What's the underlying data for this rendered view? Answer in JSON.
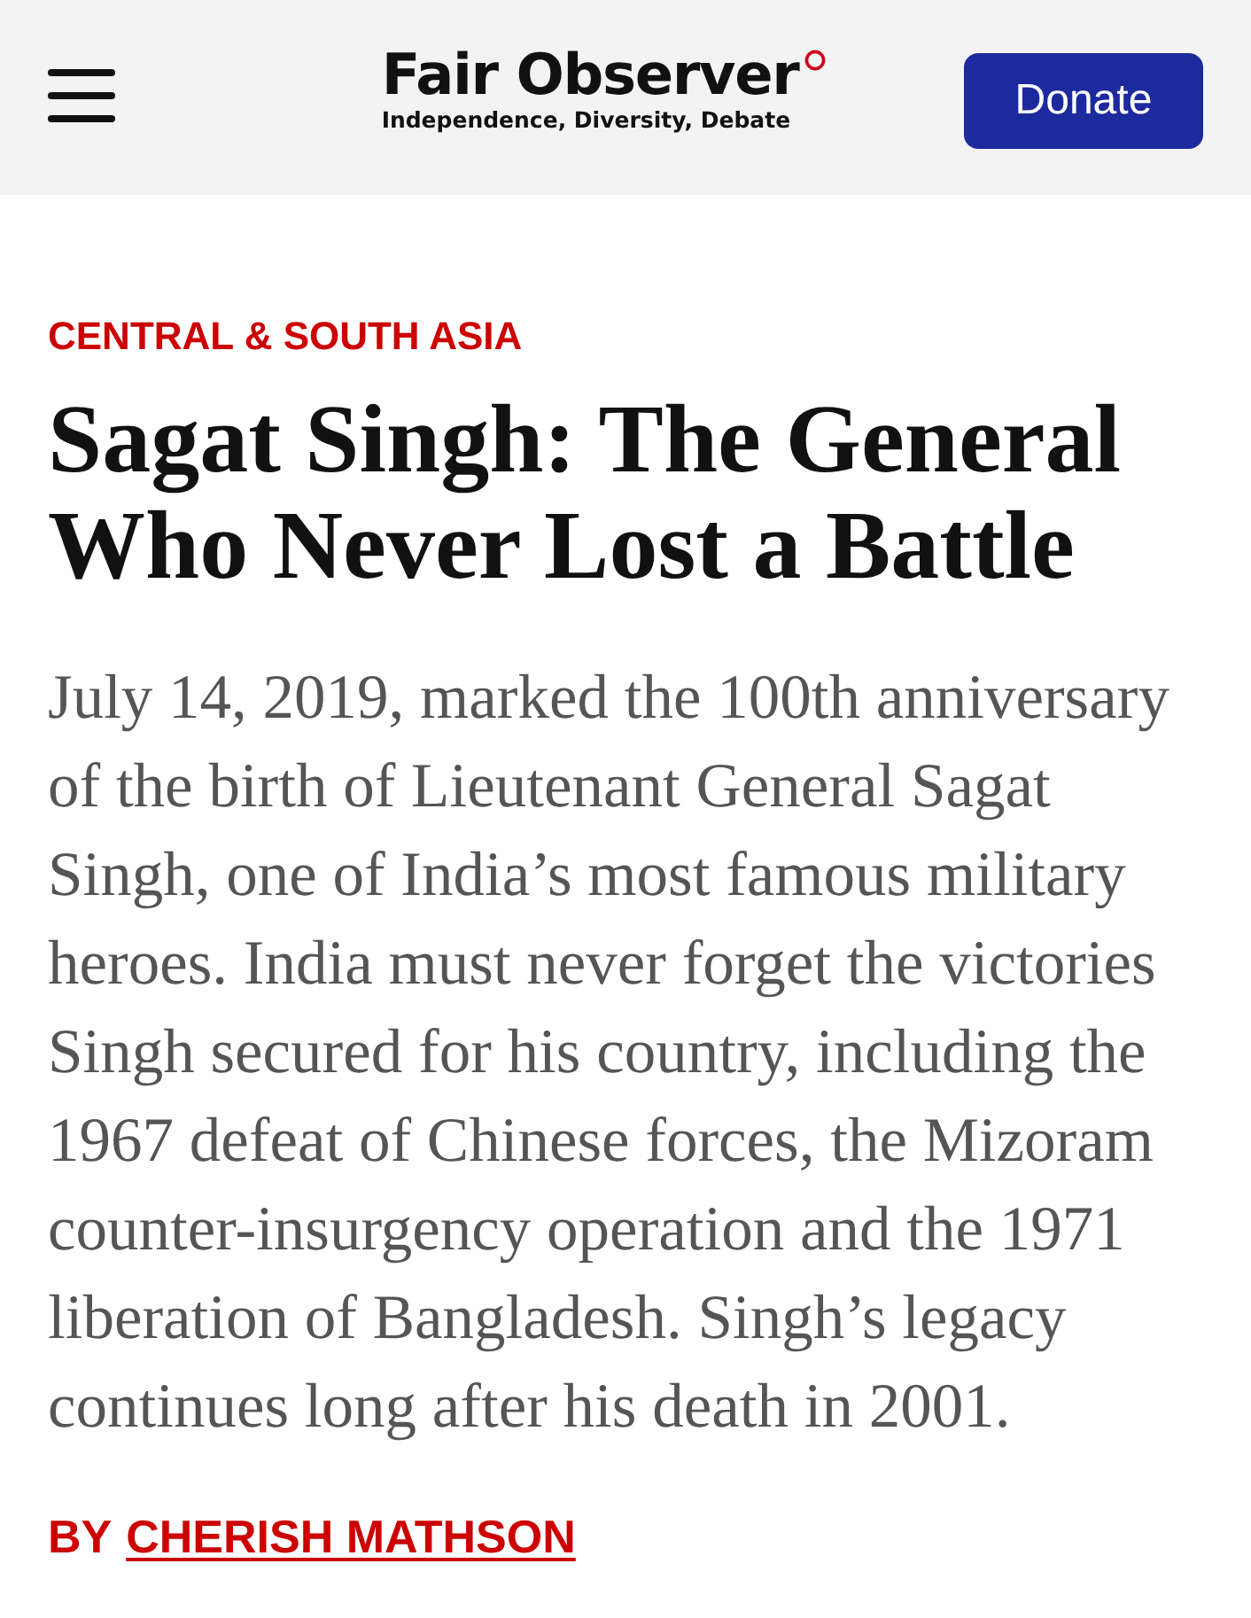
{
  "header": {
    "logo": {
      "name": "Fair Observer",
      "tagline": "Independence, Diversity, Debate"
    },
    "donate_button": "Donate"
  },
  "article": {
    "category": "CENTRAL & SOUTH ASIA",
    "title": "Sagat Singh: The General Who Never Lost a Battle",
    "summary": "July 14, 2019, marked the 100th anniversary of the birth of Lieutenant General Sagat Singh, one of India’s most famous military heroes. India must never forget the victories Singh secured for his country, including the 1967 defeat of Chinese forces, the Mizoram counter-insurgency operation and the 1971 liberation of Bangladesh. Singh’s legacy continues long after his death in 2001.",
    "byline": {
      "prefix": "BY",
      "author": "CHERISH MATHSON"
    }
  }
}
